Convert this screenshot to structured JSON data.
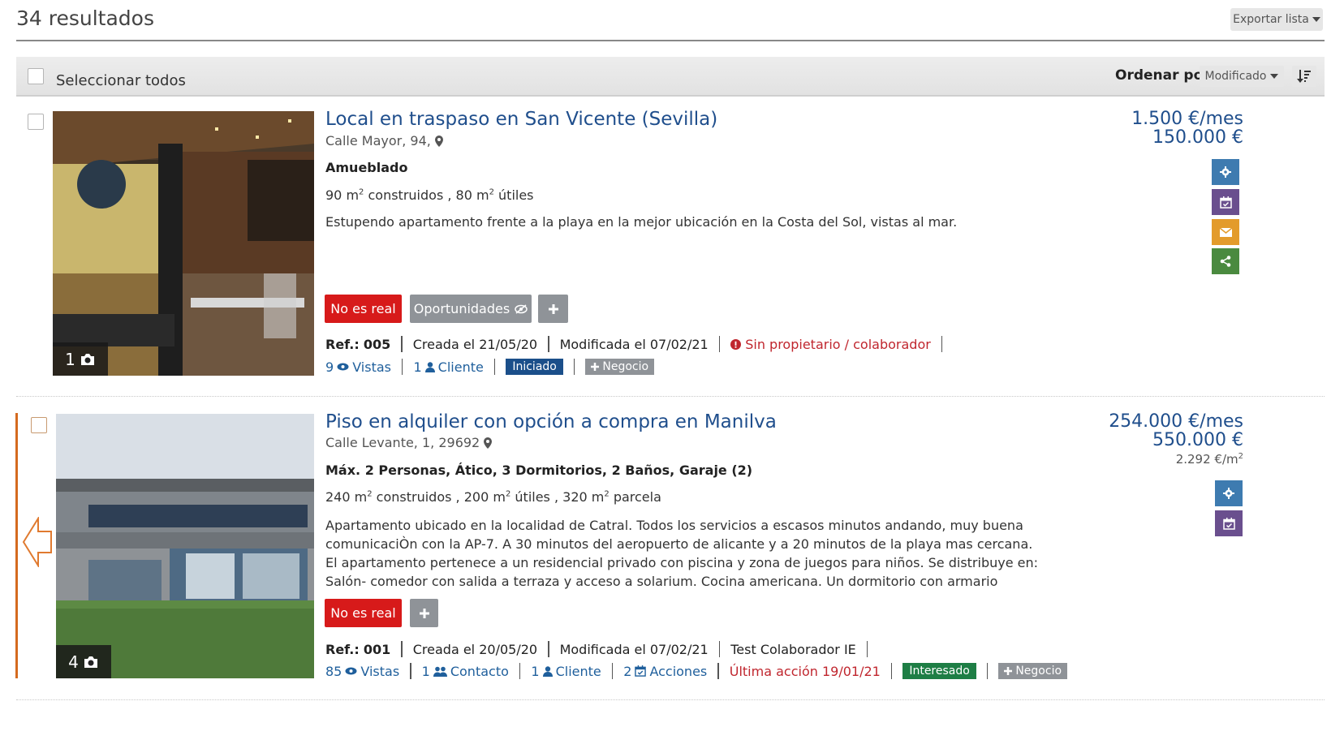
{
  "header": {
    "results_text": "34 resultados",
    "export_label": "Exportar lista"
  },
  "toolbar": {
    "select_all_label": "Seleccionar todos",
    "sort_label": "Ordenar por:",
    "sort_value": "Modificado"
  },
  "listings": [
    {
      "title": "Local en traspaso en San Vicente (Sevilla)",
      "address": "Calle Mayor, 94,",
      "features": "Amueblado",
      "area_built": "90 m",
      "area_built_suffix": " construidos , ",
      "area_useful": "80 m",
      "area_useful_suffix": " útiles",
      "description": "Estupendo apartamento frente a la playa en la mejor ubicación en la Costa del Sol, vistas al mar.",
      "photo_count": "1",
      "tag_label": "No es real",
      "opportunities_label": "Oportunidades",
      "ref_label": "Ref.:",
      "ref_value": "005",
      "created": "Creada el 21/05/20",
      "modified": "Modificada el 07/02/21",
      "warning": "Sin propietario / colaborador",
      "views": "9",
      "views_label": "Vistas",
      "clients": "1",
      "clients_label": "Cliente",
      "status": "Iniciado",
      "status_color": "#1b4f8a",
      "business_label": "Negocio",
      "price_rent": "1.500 €/mes",
      "price_sale": "150.000 €",
      "actions": [
        "gear-icon",
        "calendar-icon",
        "envelope-icon",
        "share-icon"
      ]
    },
    {
      "title": "Piso en alquiler con opción a compra en Manilva",
      "address": "Calle Levante, 1, 29692",
      "features": "Máx. 2 Personas, Ático, 3 Dormitorios, 2 Baños, Garaje (2)",
      "area_built": "240 m",
      "area_built_suffix": " construidos , ",
      "area_useful": "200 m",
      "area_useful_suffix": " útiles , ",
      "area_plot": "320 m",
      "area_plot_suffix": " parcela",
      "description": "Apartamento ubicado en la localidad de Catral. Todos los servicios a escasos minutos andando, muy buena comunicaciÒn con la AP-7. A 30 minutos del aeropuerto de alicante y a 20 minutos de la playa mas cercana. El apartamento pertenece a un residencial privado con piscina y zona de juegos para niños. Se distribuye en: Salón- comedor con salida a terraza y acceso a solarium. Cocina americana. Un dormitorio con armario empotrado. Baño completo Solarium con la misma...",
      "photo_count": "4",
      "tag_label": "No es real",
      "ref_label": "Ref.:",
      "ref_value": "001",
      "created": "Creada el 20/05/20",
      "modified": "Modificada el 07/02/21",
      "collaborator": "Test Colaborador IE",
      "views": "85",
      "views_label": "Vistas",
      "contacts": "1",
      "contacts_label": "Contacto",
      "clients": "1",
      "clients_label": "Cliente",
      "actions_count": "2",
      "actions_label": "Acciones",
      "last_action": "Última acción 19/01/21",
      "status": "Interesado",
      "status_color": "#1e7e45",
      "business_label": "Negocio",
      "price_rent": "254.000 €/mes",
      "price_sale": "550.000 €",
      "price_per_m2": "2.292 €/m",
      "price_per_m2_sup": "2",
      "actions": [
        "gear-icon",
        "calendar-icon"
      ]
    }
  ],
  "colors": {
    "gear": "#3e7bb0",
    "calendar": "#6a4f8e",
    "envelope": "#e39b2b",
    "share": "#4a8a3f",
    "highlight_border": "#d46a1f"
  }
}
